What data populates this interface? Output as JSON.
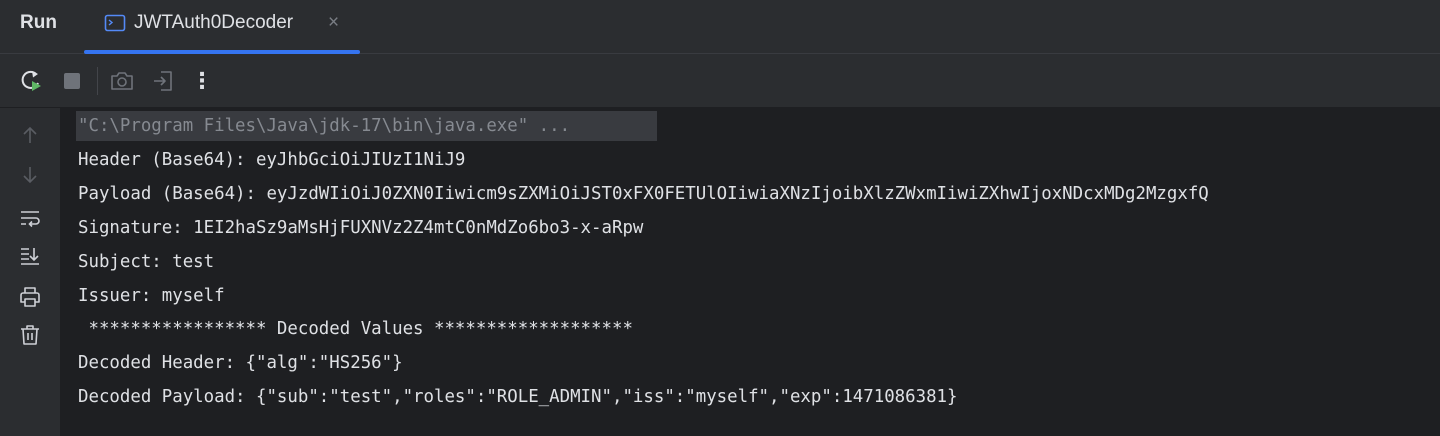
{
  "tabbar": {
    "run_label": "Run",
    "tab_title": "JWTAuth0Decoder",
    "tab_close": "×"
  },
  "toolbar": {
    "buttons": [
      "rerun-icon",
      "stop-icon",
      "screenshot-icon",
      "exit-icon",
      "more-icon"
    ],
    "more_label": "⋮"
  },
  "gutter": {
    "buttons": [
      "arrow-up-icon",
      "arrow-down-icon",
      "soft-wrap-icon",
      "scroll-to-end-icon",
      "print-icon",
      "trash-icon"
    ]
  },
  "console": {
    "command": "\"C:\\Program Files\\Java\\jdk-17\\bin\\java.exe\" ...",
    "lines": [
      "Header (Base64): eyJhbGciOiJIUzI1NiJ9",
      "Payload (Base64): eyJzdWIiOiJ0ZXN0Iiwicm9sZXMiOiJST0xFX0FETUlOIiwiaXNzIjoibXlzZWxmIiwiZXhwIjoxNDcxMDg2MzgxfQ",
      "Signature: 1EI2haSz9aMsHjFUXNVz2Z4mtC0nMdZo6bo3-x-aRpw",
      "Subject: test",
      "Issuer: myself",
      " ***************** Decoded Values *******************",
      "Decoded Header: {\"alg\":\"HS256\"}",
      "Decoded Payload: {\"sub\":\"test\",\"roles\":\"ROLE_ADMIN\",\"iss\":\"myself\",\"exp\":1471086381}"
    ]
  },
  "colors": {
    "accent": "#3574f0",
    "rerun_green": "#5fb865",
    "panel_bg": "#2b2d30",
    "console_bg": "#1e1f22"
  }
}
